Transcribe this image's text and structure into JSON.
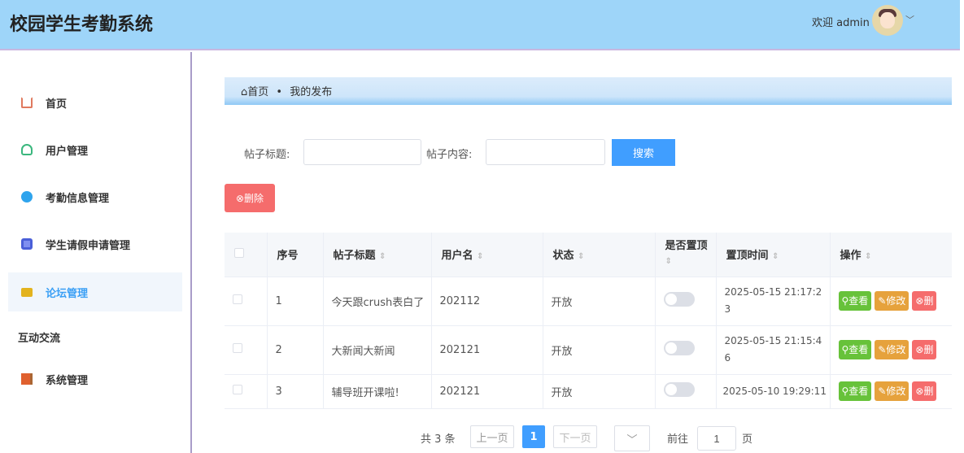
{
  "header": {
    "title": "校园学生考勤系统",
    "welcome": "欢迎 admin"
  },
  "sidebar": {
    "items": [
      {
        "label": "首页"
      },
      {
        "label": "用户管理"
      },
      {
        "label": "考勤信息管理"
      },
      {
        "label": "学生请假申请管理"
      },
      {
        "label": "论坛管理"
      }
    ],
    "group": "互动交流",
    "system": "系统管理"
  },
  "breadcrumb": {
    "home": "首页",
    "sep": "•",
    "current": "我的发布"
  },
  "filters": {
    "title_label": "帖子标题:",
    "content_label": "帖子内容:",
    "search": "搜索"
  },
  "delete_label": "删除",
  "table": {
    "headers": [
      "序号",
      "帖子标题",
      "用户名",
      "状态",
      "是否置顶",
      "置顶时间",
      "操作"
    ],
    "rows": [
      {
        "no": "1",
        "title": "今天跟crush表白了",
        "user": "202112",
        "status": "开放",
        "time": "2025-05-15 21:17:23"
      },
      {
        "no": "2",
        "title": "大新闻大新闻",
        "user": "202121",
        "status": "开放",
        "time": "2025-05-15 21:15:46"
      },
      {
        "no": "3",
        "title": "辅导班开课啦!",
        "user": "202121",
        "status": "开放",
        "time": "2025-05-10 19:29:11"
      }
    ],
    "actions": {
      "view": "查看",
      "edit": "修改",
      "delete": "删"
    }
  },
  "pagination": {
    "total": "共 3 条",
    "prev": "上一页",
    "current": "1",
    "next": "下一页",
    "goto": "前往",
    "page_value": "1",
    "page_suffix": "页"
  }
}
